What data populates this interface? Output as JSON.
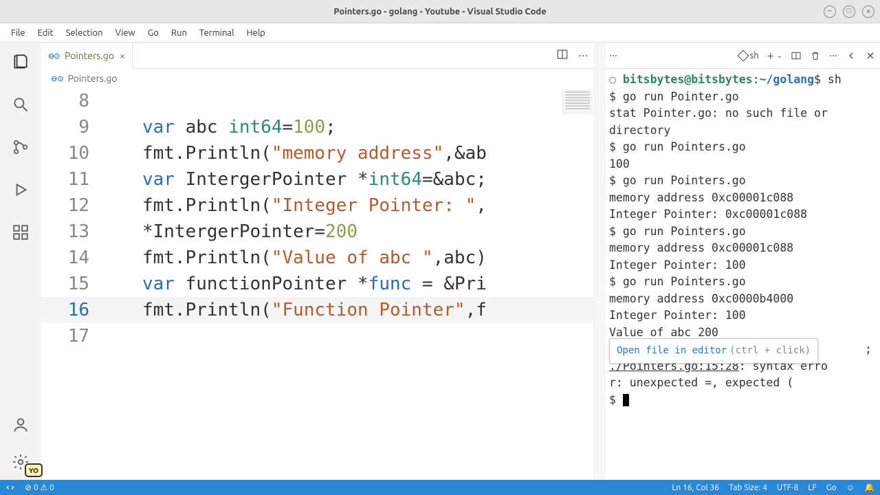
{
  "window": {
    "title": "Pointers.go - golang - Youtube - Visual Studio Code"
  },
  "menu": {
    "items": [
      "File",
      "Edit",
      "Selection",
      "View",
      "Go",
      "Run",
      "Terminal",
      "Help"
    ]
  },
  "tab": {
    "label": "Pointers.go"
  },
  "breadcrumb": {
    "label": "Pointers.go"
  },
  "code": {
    "lines": [
      {
        "n": 8,
        "seg": []
      },
      {
        "n": 9,
        "seg": [
          {
            "t": "   "
          },
          {
            "t": "var",
            "c": "kw"
          },
          {
            "t": " abc "
          },
          {
            "t": "int64",
            "c": "ty"
          },
          {
            "t": "="
          },
          {
            "t": "100",
            "c": "nm"
          },
          {
            "t": ";"
          }
        ]
      },
      {
        "n": 10,
        "seg": [
          {
            "t": "   fmt.Println("
          },
          {
            "t": "\"memory address\"",
            "c": "st"
          },
          {
            "t": ",&ab"
          }
        ]
      },
      {
        "n": 11,
        "seg": [
          {
            "t": "   "
          },
          {
            "t": "var",
            "c": "kw"
          },
          {
            "t": " IntergerPointer *"
          },
          {
            "t": "int64",
            "c": "ty"
          },
          {
            "t": "=&abc;"
          }
        ]
      },
      {
        "n": 12,
        "seg": [
          {
            "t": "   fmt.Println("
          },
          {
            "t": "\"Integer Pointer: \"",
            "c": "st"
          },
          {
            "t": ","
          }
        ]
      },
      {
        "n": 13,
        "seg": [
          {
            "t": "   *IntergerPointer="
          },
          {
            "t": "200",
            "c": "nm"
          }
        ]
      },
      {
        "n": 14,
        "seg": [
          {
            "t": "   fmt.Println("
          },
          {
            "t": "\"Value of abc \"",
            "c": "st"
          },
          {
            "t": ",abc)"
          }
        ]
      },
      {
        "n": 15,
        "seg": [
          {
            "t": "   "
          },
          {
            "t": "var",
            "c": "kw"
          },
          {
            "t": " functionPointer *"
          },
          {
            "t": "func",
            "c": "kw"
          },
          {
            "t": " = &Pri"
          }
        ]
      },
      {
        "n": 16,
        "seg": [
          {
            "t": "   fmt.Println("
          },
          {
            "t": "\"Function Pointer\"",
            "c": "st"
          },
          {
            "t": ",f"
          }
        ],
        "hl": true
      },
      {
        "n": 17,
        "seg": []
      }
    ]
  },
  "terminal": {
    "shell_label": "sh",
    "prompt_user": "bitsbytes",
    "prompt_host": "bitsbytes",
    "prompt_path": "~/golang",
    "prompt_cmd": "sh",
    "lines": [
      {
        "t": "$ go run Pointer.go"
      },
      {
        "t": "stat Pointer.go: no such file or"
      },
      {
        "t": " directory"
      },
      {
        "t": "$ go run Pointers.go"
      },
      {
        "t": "100"
      },
      {
        "t": "$ go run Pointers.go"
      },
      {
        "t": "memory address 0xc00001c088"
      },
      {
        "t": "Integer Pointer:  0xc00001c088"
      },
      {
        "t": "$ go run Pointers.go"
      },
      {
        "t": "memory address 0xc00001c088"
      },
      {
        "t": "Integer Pointer:  100"
      },
      {
        "t": "$ go run Pointers.go"
      },
      {
        "t": "memory address 0xc0000b4000"
      },
      {
        "t": "Integer Pointer:  100"
      },
      {
        "t": "Value of abc  200"
      }
    ],
    "tooltip": {
      "link": "Open file in editor",
      "hint": "(ctrl + click)"
    },
    "error_loc": "./Pointers.go:15:28",
    "error_tail1": ": syntax erro",
    "error_tail2": "r: unexpected =, expected (",
    "error_trail_semicolon": ";",
    "final_prompt": "$ "
  },
  "status": {
    "errors": "0",
    "warnings": "0",
    "pos": "Ln 16, Col 36",
    "tabsize": "Tab Size: 4",
    "enc": "UTF-8",
    "eol": "LF",
    "lang": "Go"
  },
  "yo": "YO"
}
